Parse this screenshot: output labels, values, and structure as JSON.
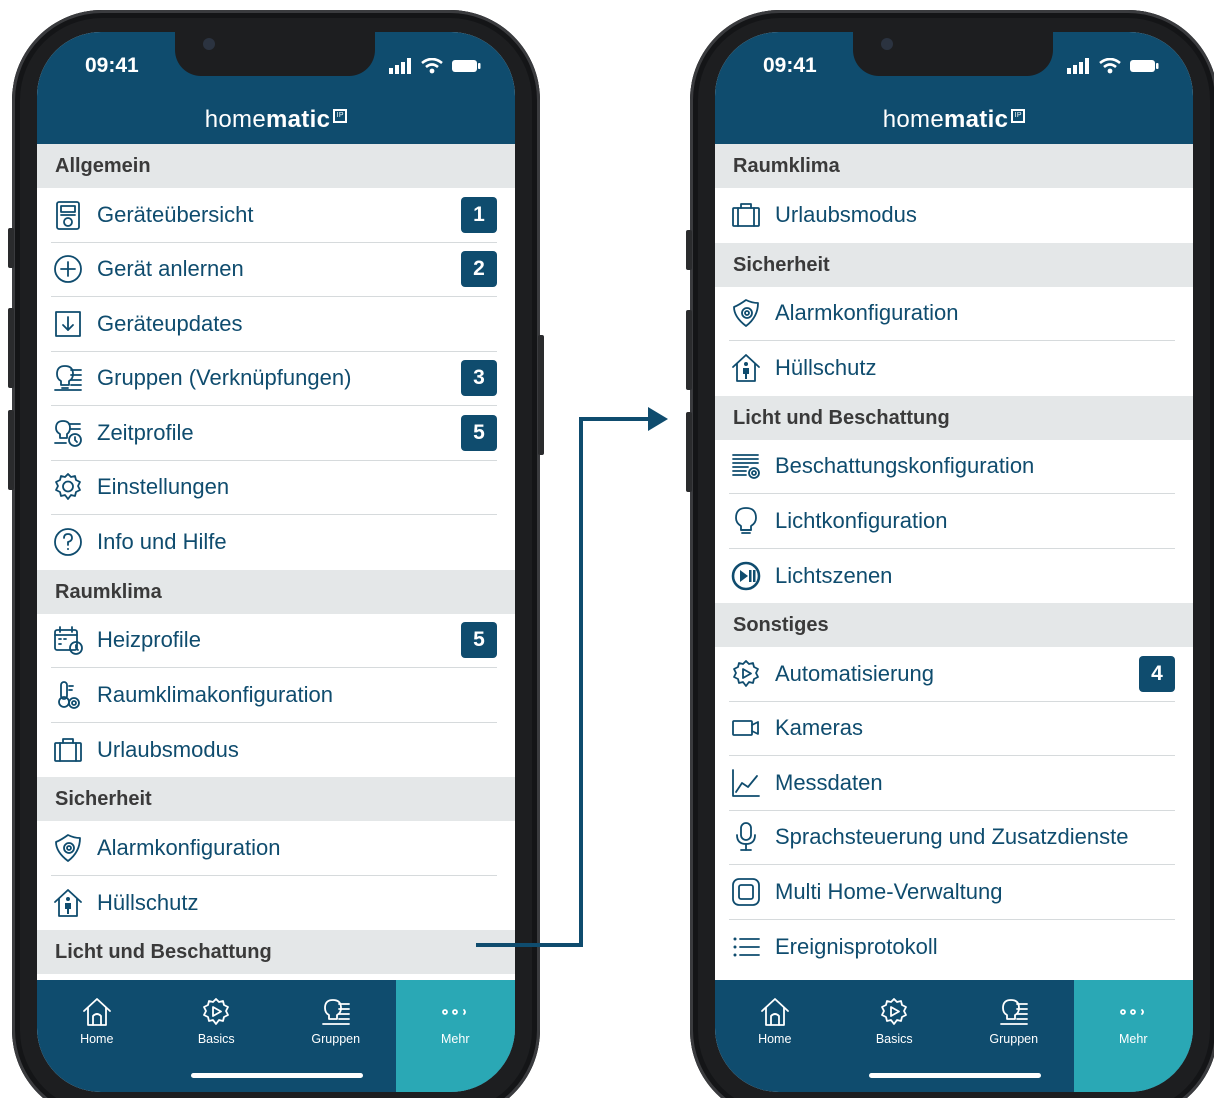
{
  "colors": {
    "primary": "#0f4c6e",
    "accent": "#2aa8b5",
    "section_bg": "#e4e7e8"
  },
  "left": {
    "time": "09:41",
    "brand": {
      "light": "home",
      "bold": "matic",
      "mark": "IP"
    },
    "sections": [
      {
        "title": "Allgemein",
        "items": [
          {
            "icon": "device-overview-icon",
            "label": "Geräteübersicht",
            "badge": "1"
          },
          {
            "icon": "add-circle-icon",
            "label": "Gerät anlernen",
            "badge": "2"
          },
          {
            "icon": "download-icon",
            "label": "Geräteupdates",
            "badge": ""
          },
          {
            "icon": "groups-icon",
            "label": "Gruppen (Verknüpfungen)",
            "badge": "3"
          },
          {
            "icon": "time-profile-icon",
            "label": "Zeitprofile",
            "badge": "5"
          },
          {
            "icon": "gear-icon",
            "label": "Einstellungen",
            "badge": ""
          },
          {
            "icon": "help-icon",
            "label": "Info und Hilfe",
            "badge": ""
          }
        ]
      },
      {
        "title": "Raumklima",
        "items": [
          {
            "icon": "heating-calendar-icon",
            "label": "Heizprofile",
            "badge": "5"
          },
          {
            "icon": "thermometer-gear-icon",
            "label": "Raumklimakonfiguration",
            "badge": ""
          },
          {
            "icon": "suitcase-icon",
            "label": "Urlaubsmodus",
            "badge": ""
          }
        ]
      },
      {
        "title": "Sicherheit",
        "items": [
          {
            "icon": "shield-gear-icon",
            "label": "Alarmkonfiguration",
            "badge": ""
          },
          {
            "icon": "house-person-icon",
            "label": "Hüllschutz",
            "badge": ""
          }
        ]
      },
      {
        "title": "Licht und Beschattung",
        "items": []
      }
    ],
    "tabs": [
      {
        "icon": "home-icon",
        "label": "Home"
      },
      {
        "icon": "basics-gear-icon",
        "label": "Basics"
      },
      {
        "icon": "groups-icon",
        "label": "Gruppen"
      },
      {
        "icon": "more-dots-icon",
        "label": "Mehr"
      }
    ]
  },
  "right": {
    "time": "09:41",
    "brand": {
      "light": "home",
      "bold": "matic",
      "mark": "IP"
    },
    "sections": [
      {
        "title": "Raumklima",
        "items": [
          {
            "icon": "suitcase-icon",
            "label": "Urlaubsmodus",
            "badge": ""
          }
        ]
      },
      {
        "title": "Sicherheit",
        "items": [
          {
            "icon": "shield-gear-icon",
            "label": "Alarmkonfiguration",
            "badge": ""
          },
          {
            "icon": "house-person-icon",
            "label": "Hüllschutz",
            "badge": ""
          }
        ]
      },
      {
        "title": "Licht und Beschattung",
        "items": [
          {
            "icon": "shading-config-icon",
            "label": "Beschattungskonfiguration",
            "badge": ""
          },
          {
            "icon": "lightbulb-icon",
            "label": "Lichtkonfiguration",
            "badge": ""
          },
          {
            "icon": "play-pause-icon",
            "label": "Lichtszenen",
            "badge": ""
          }
        ]
      },
      {
        "title": "Sonstiges",
        "items": [
          {
            "icon": "automation-gear-icon",
            "label": "Automatisierung",
            "badge": "4"
          },
          {
            "icon": "camera-icon",
            "label": "Kameras",
            "badge": ""
          },
          {
            "icon": "chart-icon",
            "label": "Messdaten",
            "badge": ""
          },
          {
            "icon": "microphone-icon",
            "label": "Sprachsteuerung und Zusatzdienste",
            "badge": ""
          },
          {
            "icon": "multi-home-icon",
            "label": "Multi Home-Verwaltung",
            "badge": ""
          },
          {
            "icon": "list-icon",
            "label": "Ereignisprotokoll",
            "badge": ""
          }
        ]
      }
    ],
    "tabs": [
      {
        "icon": "home-icon",
        "label": "Home"
      },
      {
        "icon": "basics-gear-icon",
        "label": "Basics"
      },
      {
        "icon": "groups-icon",
        "label": "Gruppen"
      },
      {
        "icon": "more-dots-icon",
        "label": "Mehr"
      }
    ]
  }
}
